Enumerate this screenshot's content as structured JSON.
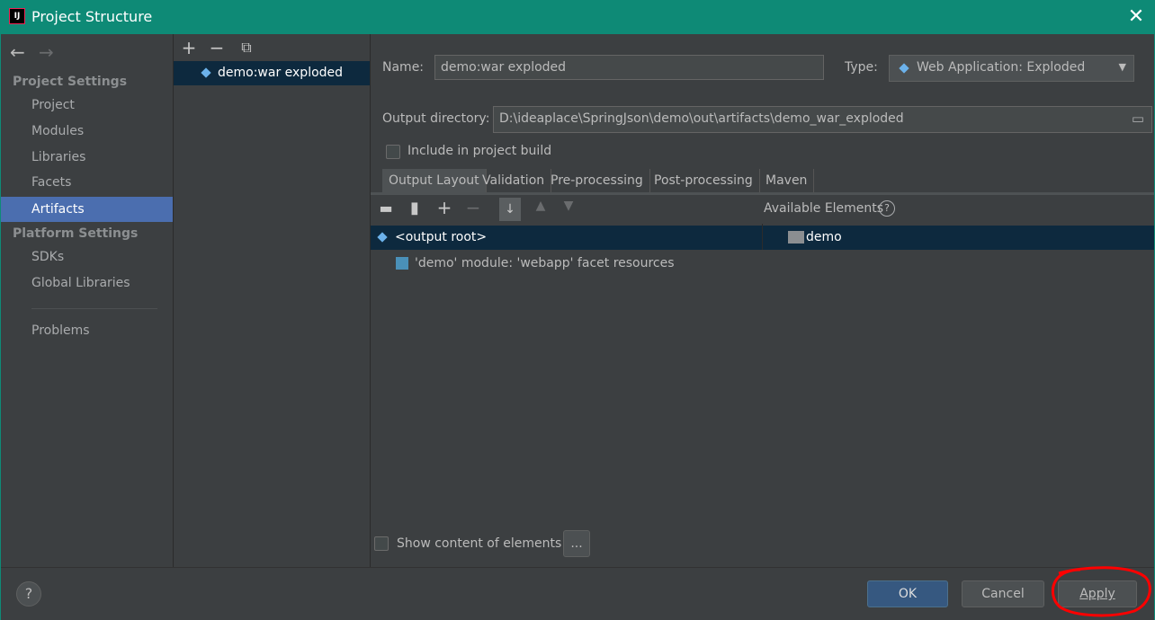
{
  "window": {
    "title": "Project Structure",
    "logo_text": "IJ"
  },
  "sidebar": {
    "section1": "Project Settings",
    "items1": [
      "Project",
      "Modules",
      "Libraries",
      "Facets",
      "Artifacts"
    ],
    "section2": "Platform Settings",
    "items2": [
      "SDKs",
      "Global Libraries"
    ],
    "problems": "Problems"
  },
  "artifacts": {
    "list": [
      "demo:war exploded"
    ]
  },
  "form": {
    "name_label": "Name:",
    "name_value": "demo:war exploded",
    "type_label": "Type:",
    "type_value": "Web Application: Exploded",
    "output_label": "Output directory:",
    "output_value": "D:\\ideaplace\\SpringJson\\demo\\out\\artifacts\\demo_war_exploded",
    "include_build": "Include in project build"
  },
  "tabs": [
    "Output Layout",
    "Validation",
    "Pre-processing",
    "Post-processing",
    "Maven"
  ],
  "layout": {
    "available_label": "Available Elements",
    "root_label": "<output root>",
    "child_label": "'demo' module: 'webapp' facet resources",
    "available_item": "demo",
    "show_content": "Show content of elements",
    "ellipsis": "..."
  },
  "buttons": {
    "help": "?",
    "ok": "OK",
    "cancel": "Cancel",
    "apply": "Apply"
  },
  "colors": {
    "title_bar": "#0e8a76",
    "selection": "#4b6eaf",
    "tree_selection": "#0d293e",
    "annotation": "#ff0000"
  }
}
